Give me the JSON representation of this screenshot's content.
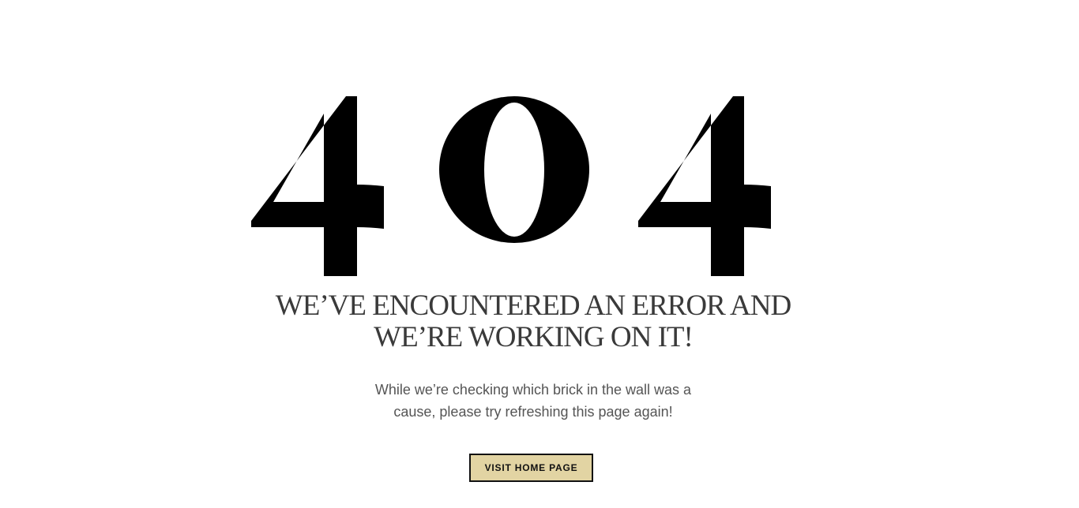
{
  "error": {
    "code_digits": [
      "4",
      "0",
      "4"
    ]
  },
  "headline": {
    "line1": "WE’VE ENCOUNTERED AN ERROR AND",
    "line2": "WE’RE WORKING ON IT!"
  },
  "message": {
    "line1": "While we’re checking which brick in the wall was a",
    "line2": "cause, please try refreshing this page again!"
  },
  "button": {
    "label": "VISIT HOME PAGE"
  },
  "colors": {
    "background": "#ffffff",
    "digits": "#000000",
    "headline": "#3a3a3a",
    "body_text": "#555555",
    "button_fill": "#e2d4a3",
    "button_border": "#111111"
  }
}
